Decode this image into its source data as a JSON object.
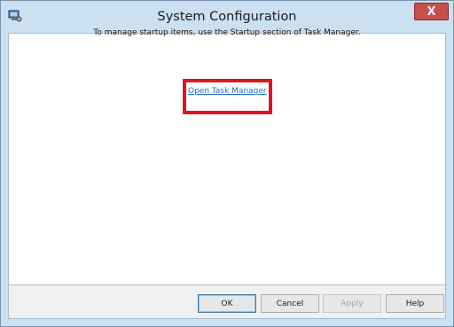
{
  "window": {
    "title": "System Configuration",
    "close_label": "X"
  },
  "content": {
    "message": "To manage startup items, use the Startup section of Task Manager.",
    "link_text": "Open Task Manager"
  },
  "buttons": {
    "ok": "OK",
    "cancel": "Cancel",
    "apply": "Apply",
    "help": "Help"
  },
  "colors": {
    "highlight": "#e3141d",
    "link": "#1f6fc7",
    "close_button": "#c7504a",
    "frame": "#cbe0f1"
  },
  "icons": {
    "app": "system-configuration-icon",
    "close": "close-icon"
  }
}
